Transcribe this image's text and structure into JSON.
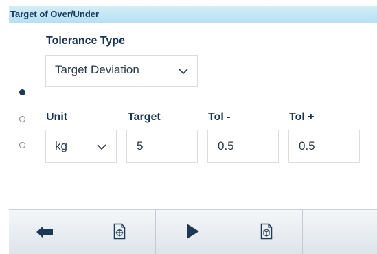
{
  "title": "Target of Over/Under",
  "tolerance_type": {
    "label": "Tolerance Type",
    "selected": "Target Deviation"
  },
  "unit": {
    "label": "Unit",
    "selected": "kg"
  },
  "target": {
    "label": "Target",
    "value": "5"
  },
  "tol_minus": {
    "label": "Tol -",
    "value": "0.5"
  },
  "tol_plus": {
    "label": "Tol +",
    "value": "0.5"
  },
  "page_indicator": {
    "pages": 3,
    "active": 1
  },
  "softkeys": [
    {
      "icon": "back-arrow-icon"
    },
    {
      "icon": "target-weight-icon"
    },
    {
      "icon": "play-icon"
    },
    {
      "icon": "tare-container-icon"
    },
    {
      "icon": ""
    }
  ],
  "colors": {
    "title_bar": "#c4e6f6",
    "text": "#173553",
    "field_border": "#d9dde2",
    "softkey_bar": "#e6ecf0"
  }
}
